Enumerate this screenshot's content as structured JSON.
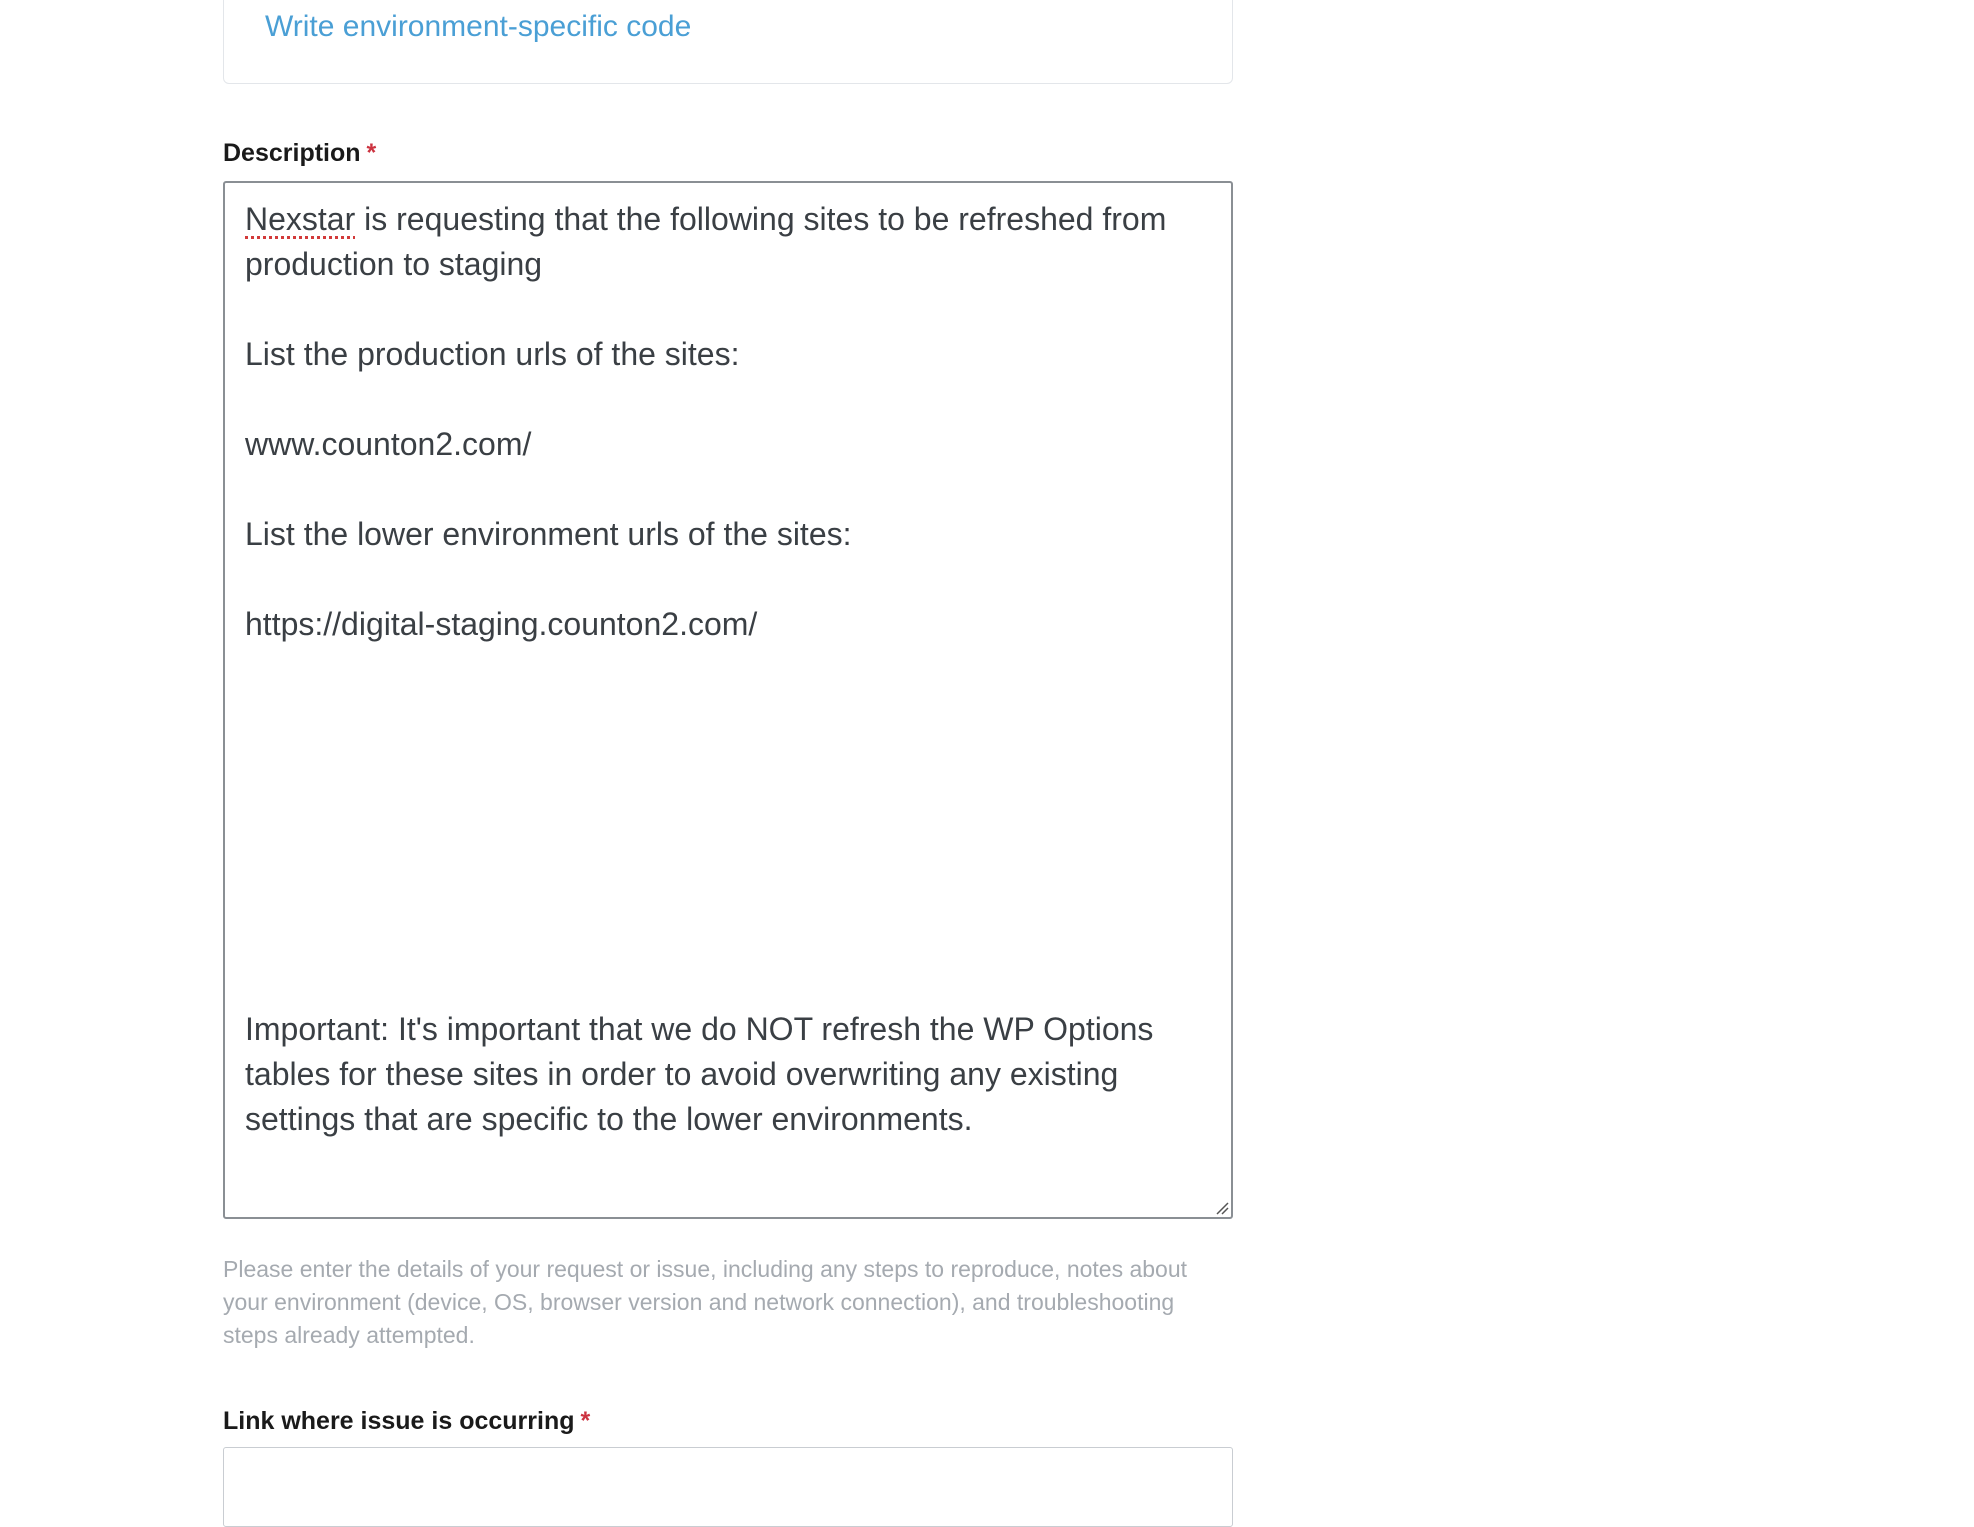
{
  "suggestion": {
    "link_text": "Write environment-specific code"
  },
  "description": {
    "label": "Description",
    "required_marker": "*",
    "first_word_flagged": "Nexstar",
    "first_line_rest": " is requesting that the following sites to be refreshed from",
    "lines": [
      "production to staging",
      "",
      "List the production urls of the sites:",
      "",
      "www.counton2.com/",
      "",
      "List the lower environment urls of the sites:",
      "",
      "https://digital-staging.counton2.com/",
      "",
      "",
      "",
      "",
      "",
      "",
      "",
      "",
      "Important: It's important that we do NOT refresh the WP Options",
      "tables for these sites in order to avoid overwriting any existing",
      "settings that are specific to the lower environments."
    ],
    "hint": "Please enter the details of your request or issue, including any steps to reproduce, notes about your environment (device, OS, browser version and network connection), and troubleshooting steps already attempted."
  },
  "link_field": {
    "label": "Link where issue is occurring",
    "required_marker": "*",
    "value": ""
  }
}
